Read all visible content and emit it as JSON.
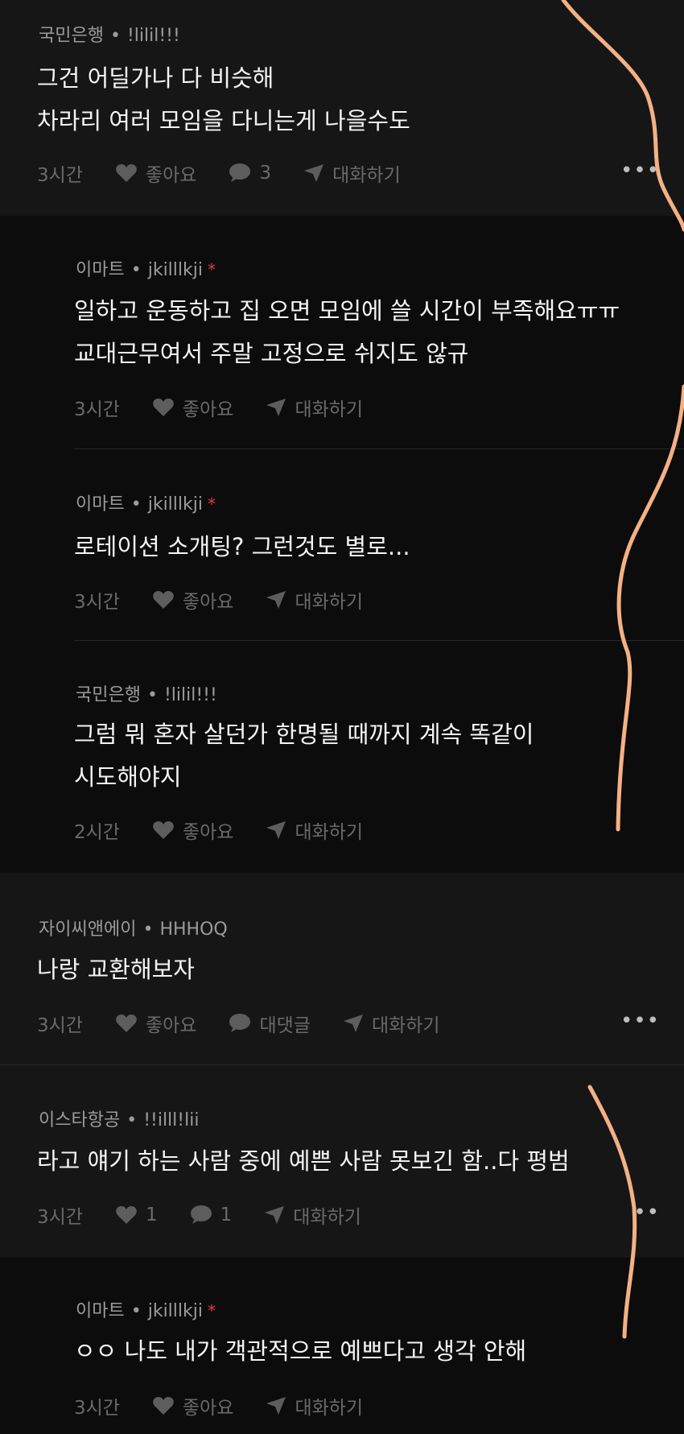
{
  "comments": [
    {
      "company": "국민은행",
      "user": "!lilil!!!",
      "lines": [
        "그건 어딜가나 다 비슷해",
        "차라리 여러 모임을 다니는게 나을수도"
      ],
      "time": "3시간",
      "like_label": "좋아요",
      "reply_count": "3",
      "chat_label": "대화하기",
      "more": "•••"
    },
    {
      "company": "이마트",
      "user": "jkilllkji",
      "star": "*",
      "lines": [
        "일하고 운동하고 집 오면 모임에 쓸 시간이 부족해요ㅠㅠ",
        "교대근무여서 주말 고정으로 쉬지도 않규"
      ],
      "time": "3시간",
      "like_label": "좋아요",
      "chat_label": "대화하기"
    },
    {
      "company": "이마트",
      "user": "jkilllkji",
      "star": "*",
      "lines": [
        "로테이션 소개팅? 그런것도 별로..."
      ],
      "time": "3시간",
      "like_label": "좋아요",
      "chat_label": "대화하기"
    },
    {
      "company": "국민은행",
      "user": "!lilil!!!",
      "lines": [
        "그럼 뭐 혼자 살던가 한명될 때까지 계속 똑같이",
        "시도해야지"
      ],
      "time": "2시간",
      "like_label": "좋아요",
      "chat_label": "대화하기"
    },
    {
      "company": "자이씨앤에이",
      "user": "HHHOQ",
      "lines": [
        "나랑 교환해보자"
      ],
      "time": "3시간",
      "like_label": "좋아요",
      "reply_label": "대댓글",
      "chat_label": "대화하기",
      "more": "•••"
    },
    {
      "company": "이스타항공",
      "user": "!!illl!lii",
      "lines": [
        "라고 얘기 하는 사람 중에 예쁜 사람 못보긴 함..다 평범"
      ],
      "time": "3시간",
      "like_count": "1",
      "reply_count": "1",
      "chat_label": "대화하기",
      "more": "••"
    },
    {
      "company": "이마트",
      "user": "jkilllkji",
      "star": "*",
      "lines": [
        "ㅇㅇ 나도 내가 객관적으로 예쁘다고 생각 안해"
      ],
      "time": "3시간",
      "like_label": "좋아요",
      "chat_label": "대화하기"
    }
  ],
  "colors": {
    "background": "#161616",
    "reply_background": "#0c0c0c",
    "scribble": "#f4b184",
    "star": "#e23b3b"
  },
  "icons": [
    "heart-icon",
    "speech-bubble-icon",
    "send-icon",
    "more-icon"
  ]
}
